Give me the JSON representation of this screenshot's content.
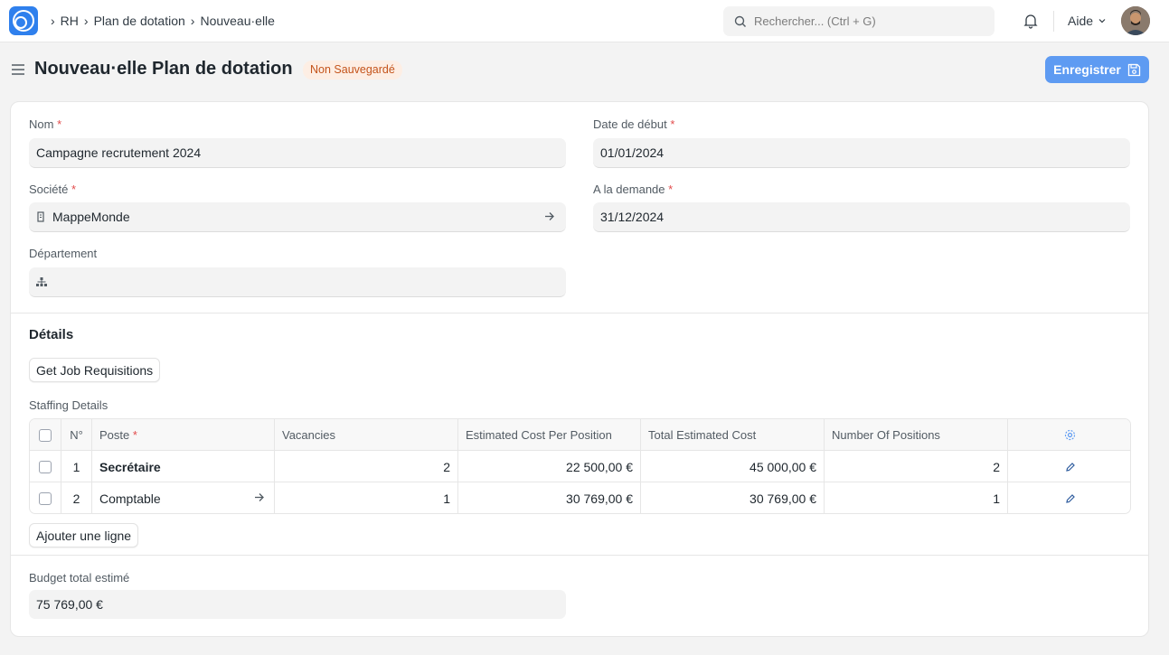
{
  "breadcrumb": [
    "RH",
    "Plan de dotation",
    "Nouveau·elle"
  ],
  "search": {
    "placeholder": "Rechercher... (Ctrl + G)"
  },
  "navbar": {
    "help_label": "Aide"
  },
  "page": {
    "title": "Nouveau·elle Plan de dotation",
    "status_badge": "Non Sauvegardé",
    "save_label": "Enregistrer"
  },
  "form": {
    "nom": {
      "label": "Nom",
      "required": "*",
      "value": "Campagne recrutement 2024"
    },
    "date_debut": {
      "label": "Date de début",
      "required": "*",
      "value": "01/01/2024"
    },
    "societe": {
      "label": "Société",
      "required": "*",
      "value": "MappeMonde"
    },
    "a_la_demande": {
      "label": "A la demande",
      "required": "*",
      "value": "31/12/2024"
    },
    "departement": {
      "label": "Département",
      "value": ""
    }
  },
  "details": {
    "section_title": "Détails",
    "get_requisitions_label": "Get Job Requisitions",
    "table_label": "Staffing Details",
    "columns": [
      "N°",
      "Poste",
      "Vacancies",
      "Estimated Cost Per Position",
      "Total Estimated Cost",
      "Number Of Positions"
    ],
    "poste_required": "*",
    "rows": [
      {
        "no": "1",
        "poste": "Secrétaire",
        "vacancies": "2",
        "cost_per_position": "22 500,00 €",
        "total_cost": "45 000,00 €",
        "positions": "2"
      },
      {
        "no": "2",
        "poste": "Comptable",
        "vacancies": "1",
        "cost_per_position": "30 769,00 €",
        "total_cost": "30 769,00 €",
        "positions": "1"
      }
    ],
    "add_row_label": "Ajouter une ligne"
  },
  "total": {
    "label": "Budget total estimé",
    "value": "75 769,00 €"
  },
  "colors": {
    "primary": "#5e9bf2",
    "badge_bg": "#fdeee4",
    "badge_text": "#c4541b",
    "required": "#e24c4c"
  }
}
